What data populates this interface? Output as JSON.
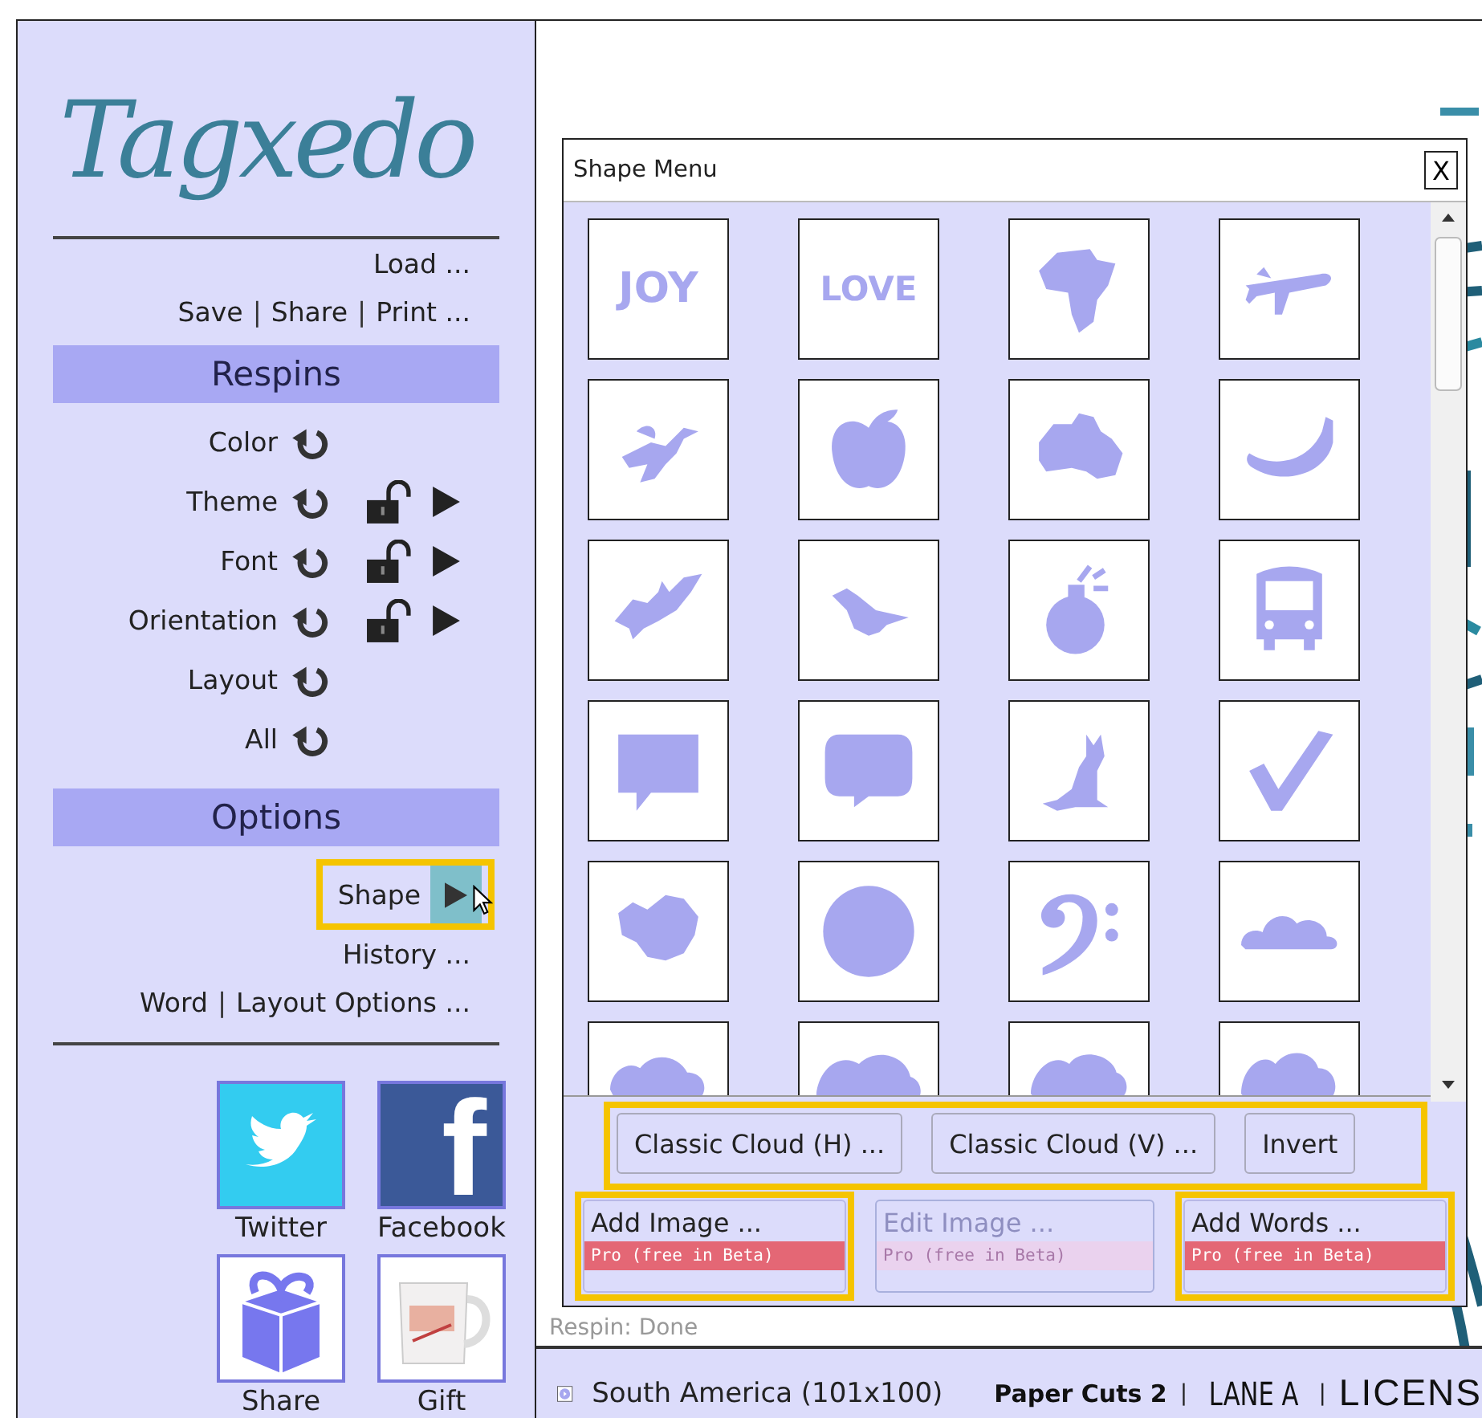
{
  "logo": {
    "text": "Tagxedo"
  },
  "file_links": {
    "load": "Load ...",
    "separator": "|",
    "links": [
      "Save",
      "Share",
      "Print ..."
    ]
  },
  "respins": {
    "title": "Respins",
    "items": [
      {
        "label": "Color",
        "kind": "simple"
      },
      {
        "label": "Theme",
        "kind": "lockable",
        "locked": false
      },
      {
        "label": "Font",
        "kind": "lockable",
        "locked": false
      },
      {
        "label": "Orientation",
        "kind": "lockable",
        "locked": false
      },
      {
        "label": "Layout",
        "kind": "simple"
      },
      {
        "label": "All",
        "kind": "simple"
      }
    ]
  },
  "options": {
    "title": "Options",
    "items": [
      {
        "kind": "menu",
        "label": "Shape",
        "highlighted": true
      },
      {
        "kind": "link",
        "label": "History ..."
      },
      {
        "kind": "links",
        "links": [
          "Word",
          "Layout Options ..."
        ],
        "separator": "|"
      }
    ]
  },
  "facebook_logo": {
    "text": "f"
  },
  "social": [
    {
      "kind": "twitter",
      "label": "Twitter"
    },
    {
      "kind": "facebook",
      "label": "Facebook"
    },
    {
      "kind": "share",
      "label": "Share"
    },
    {
      "kind": "gift",
      "label": "Gift"
    }
  ],
  "shape_menu": {
    "title": "Shape Menu",
    "close": "X",
    "shapes": [
      {
        "kind": "text",
        "label": "JOY"
      },
      {
        "kind": "text",
        "label": "LOVE"
      },
      {
        "kind": "icon"
      },
      {
        "kind": "icon"
      },
      {
        "kind": "icon"
      },
      {
        "kind": "icon"
      },
      {
        "kind": "icon"
      },
      {
        "kind": "icon"
      },
      {
        "kind": "icon"
      },
      {
        "kind": "icon"
      },
      {
        "kind": "icon"
      },
      {
        "kind": "icon"
      },
      {
        "kind": "icon"
      },
      {
        "kind": "icon"
      },
      {
        "kind": "icon"
      },
      {
        "kind": "icon"
      },
      {
        "kind": "icon"
      },
      {
        "kind": "icon"
      },
      {
        "kind": "icon"
      },
      {
        "kind": "icon"
      },
      {
        "kind": "icon"
      },
      {
        "kind": "icon"
      },
      {
        "kind": "icon"
      },
      {
        "kind": "icon"
      }
    ],
    "buttons_highlighted": true,
    "buttons": [
      "Classic Cloud (H) ...",
      "Classic Cloud (V) ...",
      "Invert"
    ],
    "pro_buttons": [
      {
        "label": "Add Image ...",
        "badge": "Pro (free in Beta)",
        "disabled": false,
        "highlighted": true
      },
      {
        "label": "Edit Image ...",
        "badge": "Pro (free in Beta)",
        "disabled": true,
        "highlighted": false
      },
      {
        "label": "Add Words ...",
        "badge": "Pro (free in Beta)",
        "disabled": false,
        "highlighted": true
      }
    ]
  },
  "respin_status": "Respin: Done",
  "status_bar": {
    "shape": "South America (101x100)",
    "items": [
      {
        "kind": "font",
        "text": "Paper Cuts 2"
      },
      {
        "kind": "separator",
        "text": "|"
      },
      {
        "kind": "theme",
        "text": "LANE A"
      },
      {
        "kind": "separator",
        "text": "|"
      },
      {
        "kind": "license",
        "text": "LICENS"
      }
    ]
  }
}
